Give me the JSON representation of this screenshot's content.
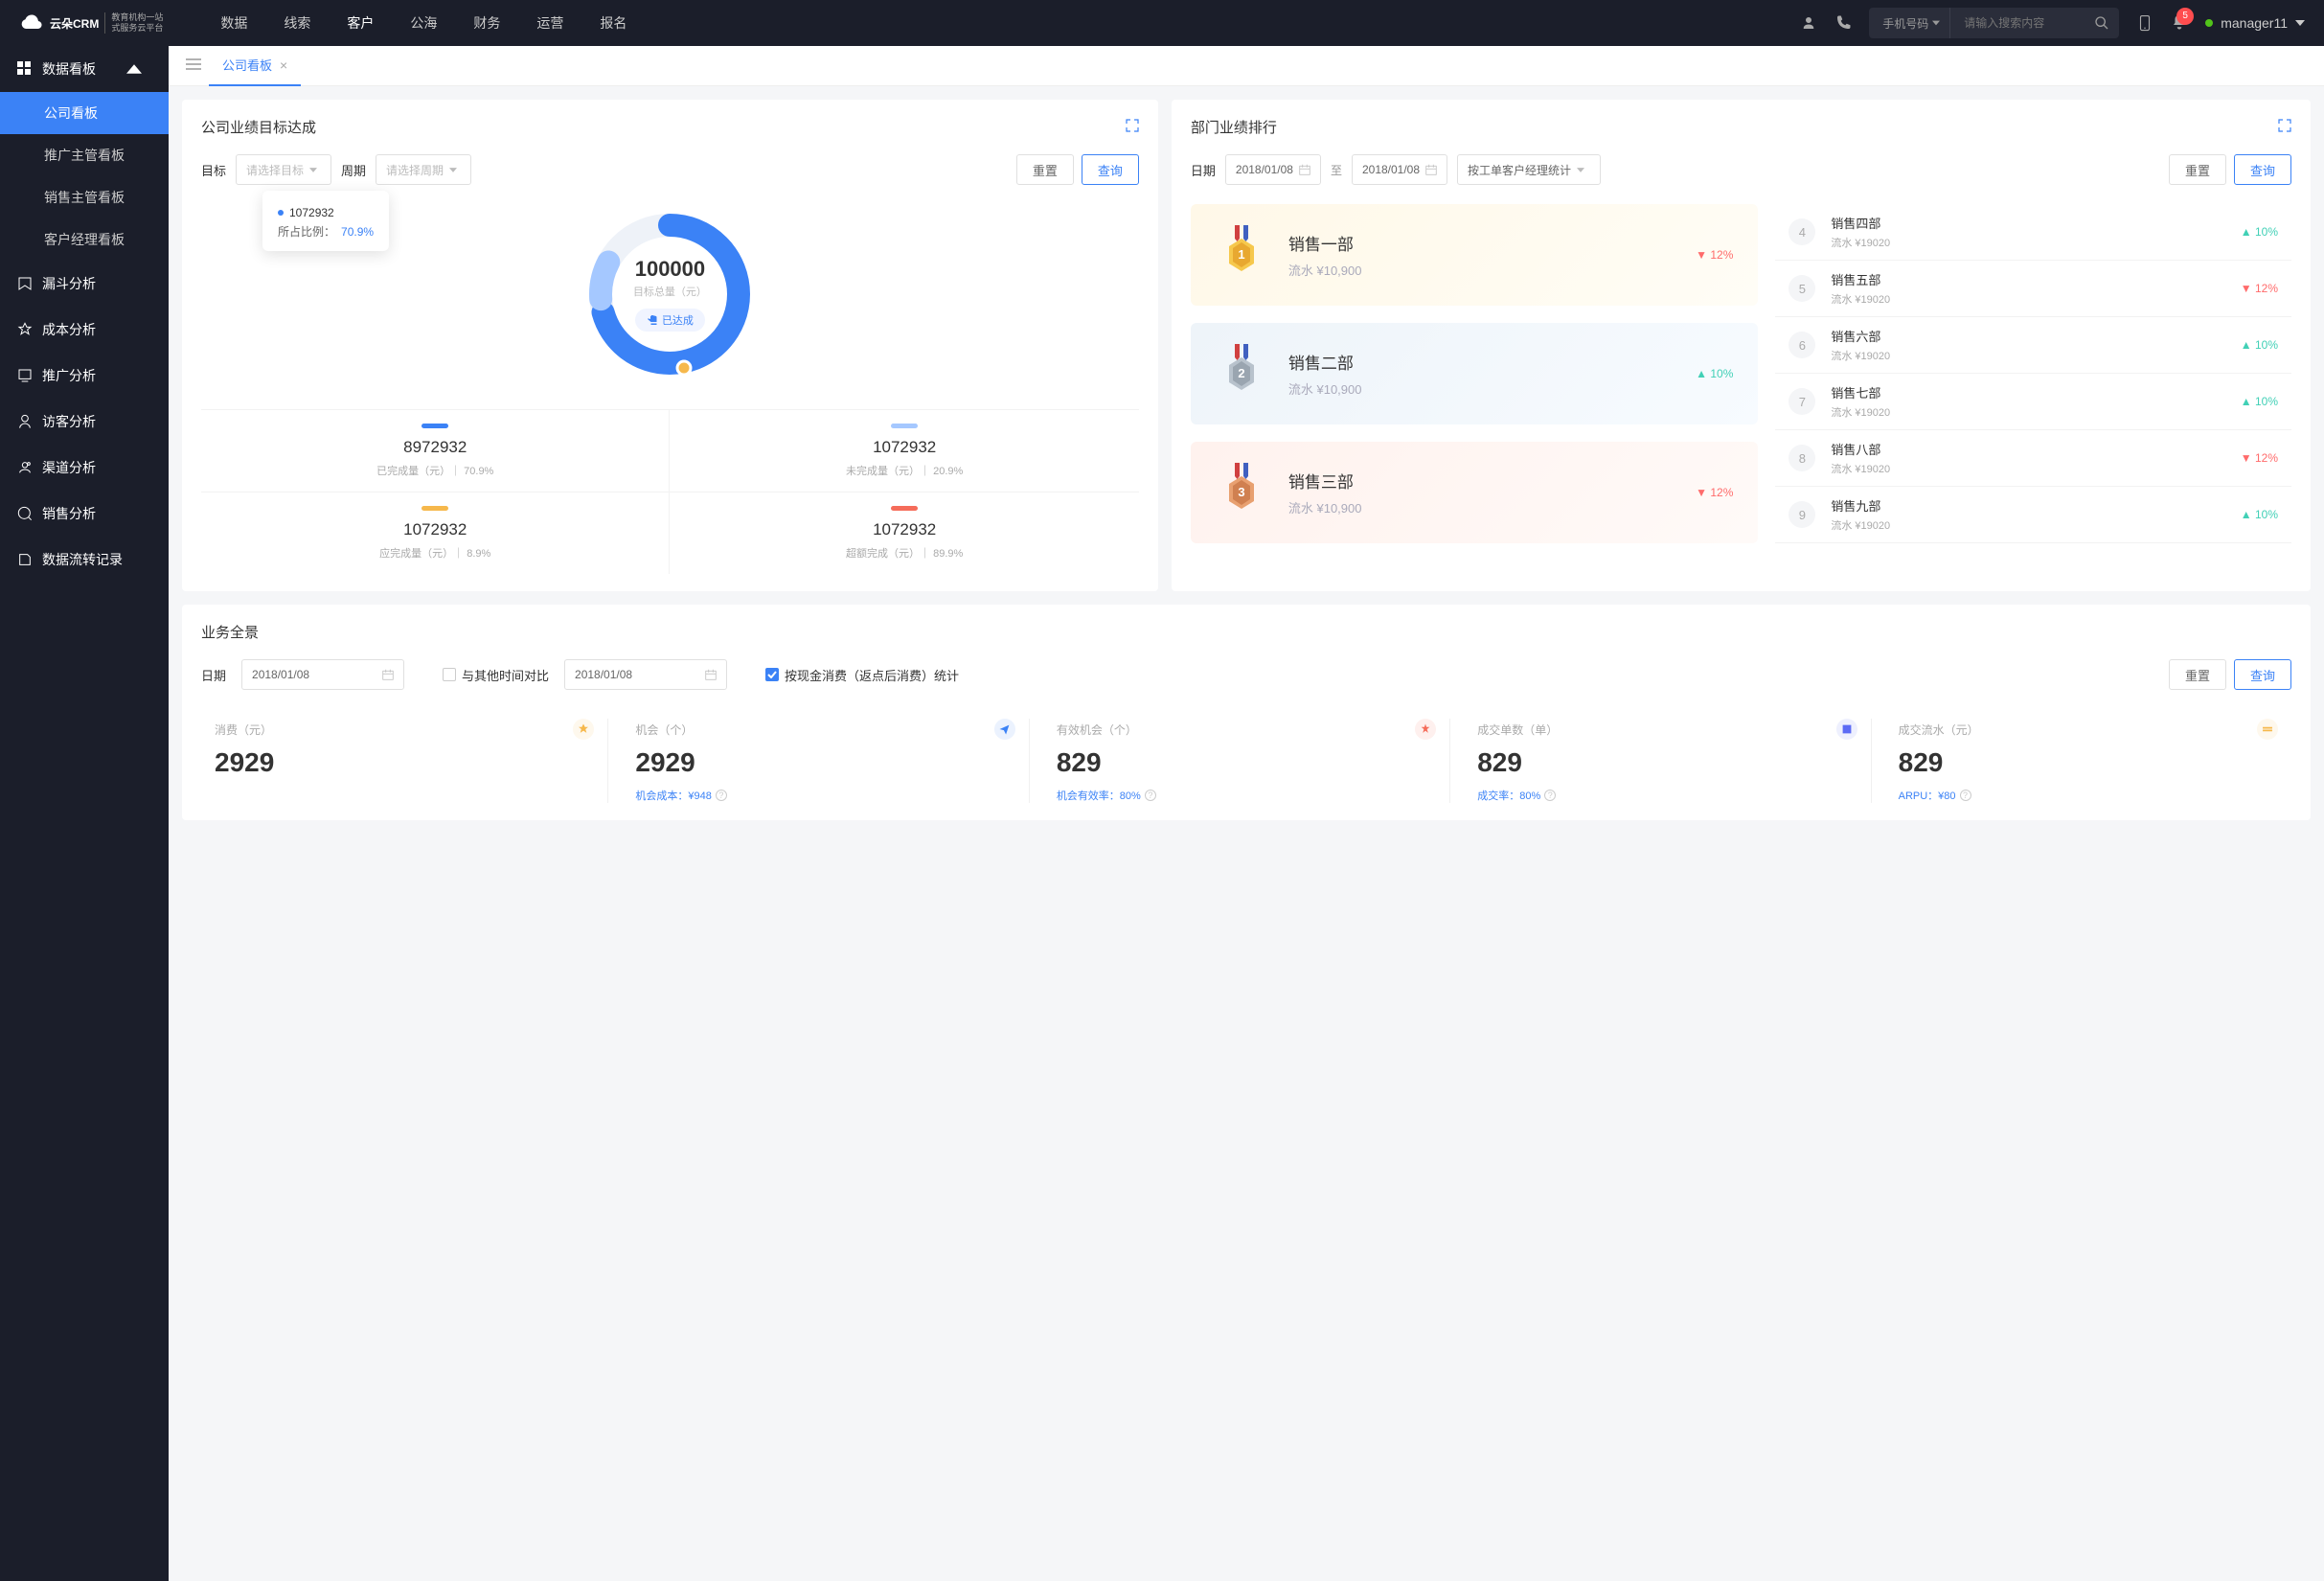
{
  "header": {
    "logo_name": "云朵CRM",
    "logo_sub1": "教育机构一站",
    "logo_sub2": "式服务云平台",
    "nav": [
      "数据",
      "线索",
      "客户",
      "公海",
      "财务",
      "运营",
      "报名"
    ],
    "nav_active_index": 2,
    "search_type": "手机号码",
    "search_placeholder": "请输入搜索内容",
    "notification_count": "5",
    "username": "manager11"
  },
  "sidebar": {
    "group_label": "数据看板",
    "items": [
      "公司看板",
      "推广主管看板",
      "销售主管看板",
      "客户经理看板"
    ],
    "active_index": 0,
    "singles": [
      "漏斗分析",
      "成本分析",
      "推广分析",
      "访客分析",
      "渠道分析",
      "销售分析",
      "数据流转记录"
    ]
  },
  "tabs": {
    "active": "公司看板"
  },
  "goal_card": {
    "title": "公司业绩目标达成",
    "label_target": "目标",
    "select_target": "请选择目标",
    "label_period": "周期",
    "select_period": "请选择周期",
    "btn_reset": "重置",
    "btn_query": "查询",
    "donut_value": "100000",
    "donut_label": "目标总量（元）",
    "donut_badge": "已达成",
    "tooltip_title": "1072932",
    "tooltip_label": "所占比例：",
    "tooltip_val": "70.9%",
    "stats": [
      {
        "color": "#3b82f6",
        "value": "8972932",
        "desc": "已完成量（元）｜ 70.9%"
      },
      {
        "color": "#a5c8ff",
        "value": "1072932",
        "desc": "未完成量（元）｜ 20.9%"
      },
      {
        "color": "#f6b84c",
        "value": "1072932",
        "desc": "应完成量（元）｜ 8.9%"
      },
      {
        "color": "#f56c5a",
        "value": "1072932",
        "desc": "超额完成（元）｜ 89.9%"
      }
    ]
  },
  "rank_card": {
    "title": "部门业绩排行",
    "label_date": "日期",
    "date1": "2018/01/08",
    "date_sep": "至",
    "date2": "2018/01/08",
    "select_stat": "按工单客户经理统计",
    "btn_reset": "重置",
    "btn_query": "查询",
    "podium": [
      {
        "name": "销售一部",
        "sub": "流水 ¥10,900",
        "pct": "12%",
        "dir": "down",
        "bg": "linear-gradient(135deg,#fff8e8,#fffdf6)"
      },
      {
        "name": "销售二部",
        "sub": "流水 ¥10,900",
        "pct": "10%",
        "dir": "up",
        "bg": "linear-gradient(135deg,#eef4f9,#f7fbff)"
      },
      {
        "name": "销售三部",
        "sub": "流水 ¥10,900",
        "pct": "12%",
        "dir": "down",
        "bg": "linear-gradient(135deg,#fff2ee,#fffaf8)"
      }
    ],
    "list": [
      {
        "n": "4",
        "name": "销售四部",
        "sub": "流水 ¥19020",
        "pct": "10%",
        "dir": "up"
      },
      {
        "n": "5",
        "name": "销售五部",
        "sub": "流水 ¥19020",
        "pct": "12%",
        "dir": "down"
      },
      {
        "n": "6",
        "name": "销售六部",
        "sub": "流水 ¥19020",
        "pct": "10%",
        "dir": "up"
      },
      {
        "n": "7",
        "name": "销售七部",
        "sub": "流水 ¥19020",
        "pct": "10%",
        "dir": "up"
      },
      {
        "n": "8",
        "name": "销售八部",
        "sub": "流水 ¥19020",
        "pct": "12%",
        "dir": "down"
      },
      {
        "n": "9",
        "name": "销售九部",
        "sub": "流水 ¥19020",
        "pct": "10%",
        "dir": "up"
      }
    ]
  },
  "overview": {
    "title": "业务全景",
    "label_date": "日期",
    "date1": "2018/01/08",
    "check1_label": "与其他时间对比",
    "date2": "2018/01/08",
    "check2_label": "按现金消费（返点后消费）统计",
    "btn_reset": "重置",
    "btn_query": "查询",
    "metrics": [
      {
        "label": "消费（元）",
        "value": "2929",
        "sub": "",
        "color": "#f6b84c"
      },
      {
        "label": "机会（个）",
        "value": "2929",
        "sub": "机会成本：¥948",
        "color": "#3b82f6"
      },
      {
        "label": "有效机会（个）",
        "value": "829",
        "sub": "机会有效率：80%",
        "color": "#f56c5a"
      },
      {
        "label": "成交单数（单）",
        "value": "829",
        "sub": "成交率：80%",
        "color": "#5c6bf5"
      },
      {
        "label": "成交流水（元）",
        "value": "829",
        "sub": "ARPU：¥80",
        "color": "#f6b84c"
      }
    ]
  },
  "chart_data": {
    "type": "pie",
    "title": "公司业绩目标达成",
    "total_label": "目标总量（元）",
    "total_value": 100000,
    "series": [
      {
        "name": "已完成量（元）",
        "value": 8972932,
        "pct": 70.9,
        "color": "#3b82f6"
      },
      {
        "name": "未完成量（元）",
        "value": 1072932,
        "pct": 20.9,
        "color": "#a5c8ff"
      },
      {
        "name": "应完成量（元）",
        "value": 1072932,
        "pct": 8.9,
        "color": "#f6b84c"
      },
      {
        "name": "超额完成（元）",
        "value": 1072932,
        "pct": 89.9,
        "color": "#f56c5a"
      }
    ]
  }
}
